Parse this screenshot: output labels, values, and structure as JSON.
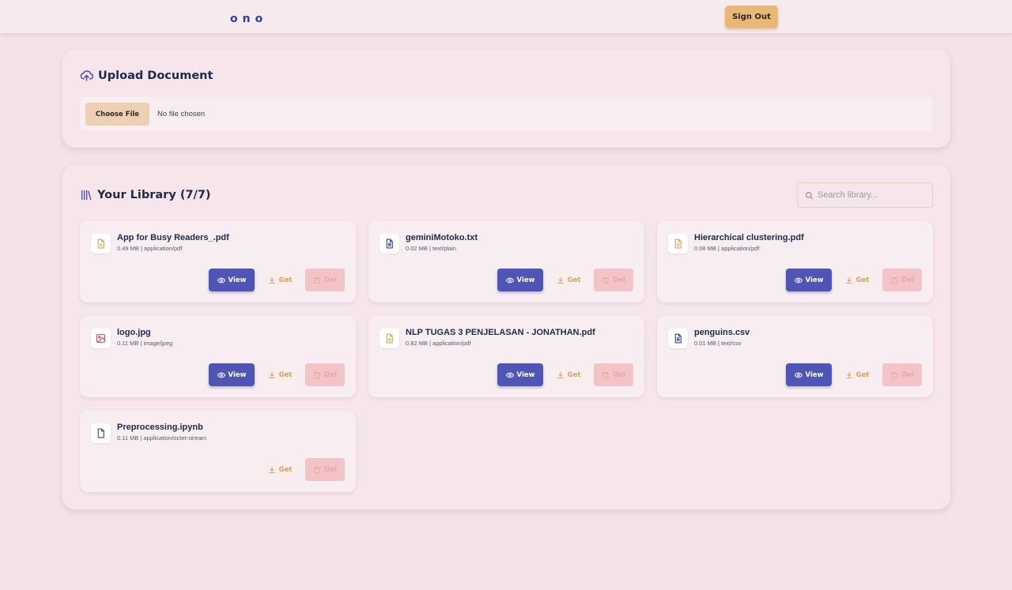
{
  "header": {
    "logo_text": "ono",
    "signout_label": "Sign Out"
  },
  "upload": {
    "title": "Upload Document",
    "choose_label": "Choose File",
    "file_status": "No file chosen"
  },
  "library": {
    "title": "Your Library (7/7)",
    "search_placeholder": "Search library..."
  },
  "buttons": {
    "view": "View",
    "get": "Get",
    "del": "Del"
  },
  "documents": [
    {
      "name": "App for Busy Readers_.pdf",
      "meta": "0.49 MB | application/pdf",
      "icon": "document-icon",
      "icon_color": "#d9a352",
      "viewable": true
    },
    {
      "name": "geminiMotoko.txt",
      "meta": "0.02 MB | text/plain",
      "icon": "text-file-icon",
      "icon_color": "#2f3f9a",
      "viewable": true
    },
    {
      "name": "Hierarchical clustering.pdf",
      "meta": "0.08 MB | application/pdf",
      "icon": "document-icon",
      "icon_color": "#d9a352",
      "viewable": true
    },
    {
      "name": "logo.jpg",
      "meta": "0.11 MB | image/jpeg",
      "icon": "image-icon",
      "icon_color": "#c9404a",
      "viewable": true
    },
    {
      "name": "NLP TUGAS 3 PENJELASAN - JONATHAN.pdf",
      "meta": "0.82 MB | application/pdf",
      "icon": "document-icon",
      "icon_color": "#d9a352",
      "viewable": true
    },
    {
      "name": "penguins.csv",
      "meta": "0.01 MB | text/csv",
      "icon": "text-file-icon",
      "icon_color": "#2f3f9a",
      "viewable": true
    },
    {
      "name": "Preprocessing.ipynb",
      "meta": "0.11 MB | application/octet-stream",
      "icon": "file-icon",
      "icon_color": "#2f3f9a",
      "viewable": false
    }
  ],
  "colors": {
    "accent": "#4e55b5",
    "get": "#d9a352",
    "delete": "#f2c4c6",
    "background": "#f3e2e7"
  }
}
